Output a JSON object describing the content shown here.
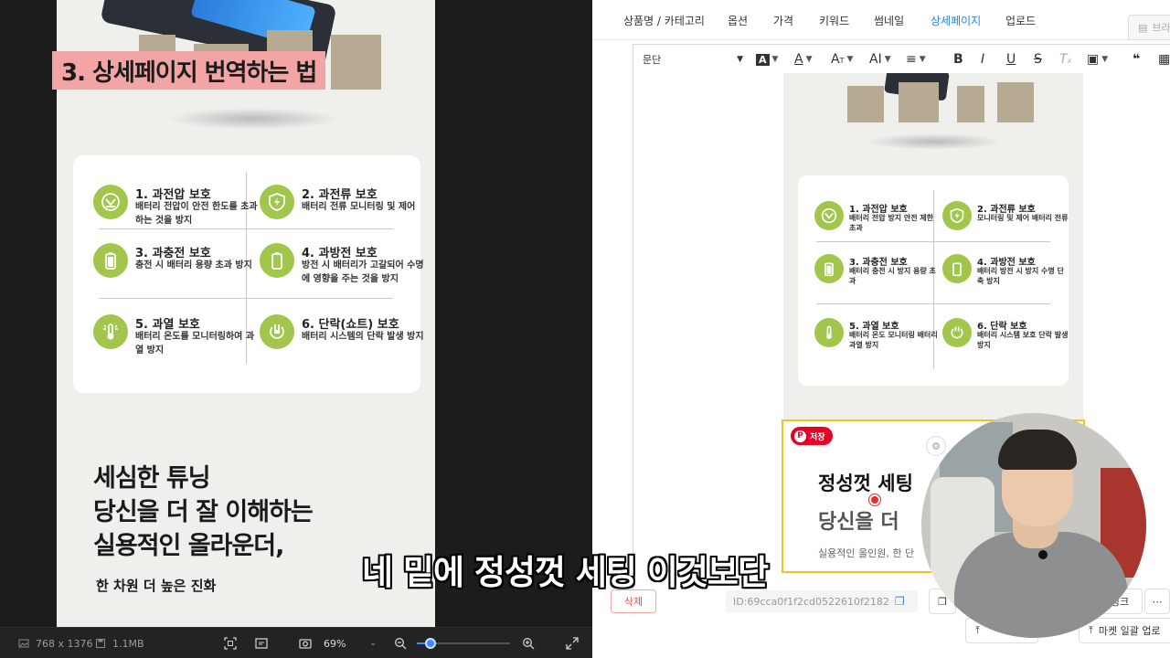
{
  "viewer": {
    "image_title": "3. 상세페이지 번역하는 법",
    "features": [
      {
        "title": "1. 과전압 보호",
        "desc": "배터리 전압이 안전 한도를 초과하는 것을 방지",
        "icon": "voltage-icon"
      },
      {
        "title": "2. 과전류 보호",
        "desc": "배터리 전류 모니터링 및 제어",
        "icon": "shield-bolt-icon"
      },
      {
        "title": "3. 과충전 보호",
        "desc": "충전 시 배터리 용량 초과 방지",
        "icon": "battery-full-icon"
      },
      {
        "title": "4. 과방전 보호",
        "desc": "방전 시 배터리가 고갈되어 수명에 영향을 주는 것을 방지",
        "icon": "battery-empty-icon"
      },
      {
        "title": "5. 과열 보호",
        "desc": "배터리 온도를 모니터링하여 과열 방지",
        "icon": "thermometer-icon"
      },
      {
        "title": "6. 단락(쇼트) 보호",
        "desc": "배터리 시스템의 단락 발생 방지",
        "icon": "plug-icon"
      }
    ],
    "copy_lines": [
      "세심한 튜닝",
      "당신을 더 잘 이해하는",
      "실용적인 올라운더,"
    ],
    "sub_copy": "한 차원 더 높은 진화",
    "status": {
      "dimensions": "768 x 1376",
      "file_size": "1.1MB",
      "zoom": "69%",
      "zoom_fraction": 0.15
    }
  },
  "editor": {
    "tabs": [
      "상품명 / 카테고리",
      "옵션",
      "가격",
      "키워드",
      "썸네일",
      "상세페이지",
      "업로드"
    ],
    "active_tab": "상세페이지",
    "tab_right_btn": "브라",
    "toolbar": {
      "paragraph": "문단"
    },
    "doc_features": [
      {
        "title": "1. 과전압 보호",
        "desc": "배터리 전압 방지 안전 제한 초과",
        "icon": "voltage-icon"
      },
      {
        "title": "2. 과전류 보호",
        "desc": "모니터링 및 제어 배터리 전류",
        "icon": "shield-bolt-icon"
      },
      {
        "title": "3. 과충전 보호",
        "desc": "배터리 충전 시 방지 용량 초과",
        "icon": "battery-full-icon"
      },
      {
        "title": "4. 과방전 보호",
        "desc": "배터리 방전 시 방지 수명 단축 방지",
        "icon": "battery-empty-icon"
      },
      {
        "title": "5. 과열 보호",
        "desc": "배터리 온도 모니터링 배터리 과열 방지",
        "icon": "thermometer-icon"
      },
      {
        "title": "6. 단락 보호",
        "desc": "배터리 시스템 보호 단락 발생 방지",
        "icon": "plug-icon"
      }
    ],
    "selected_block": {
      "save_badge": "저장",
      "headline": "정성껏 세팅",
      "subline": "당신을 더",
      "small": "실용적인 올인원, 한 단"
    },
    "footer": {
      "delete": "삭제",
      "id": "ID:69cca0f1f2cd0522610f2182",
      "link_btn": "링크",
      "more": "⋯",
      "upload_btn": "마켓 일괄 업로"
    }
  },
  "subtitle": "네 밑에 정성껏 세팅 이것보단",
  "colors": {
    "accent_green": "#a2c64b",
    "banner_pink": "#f3a5a5",
    "active_tab": "#2a86d9",
    "selection": "#f0c419"
  }
}
